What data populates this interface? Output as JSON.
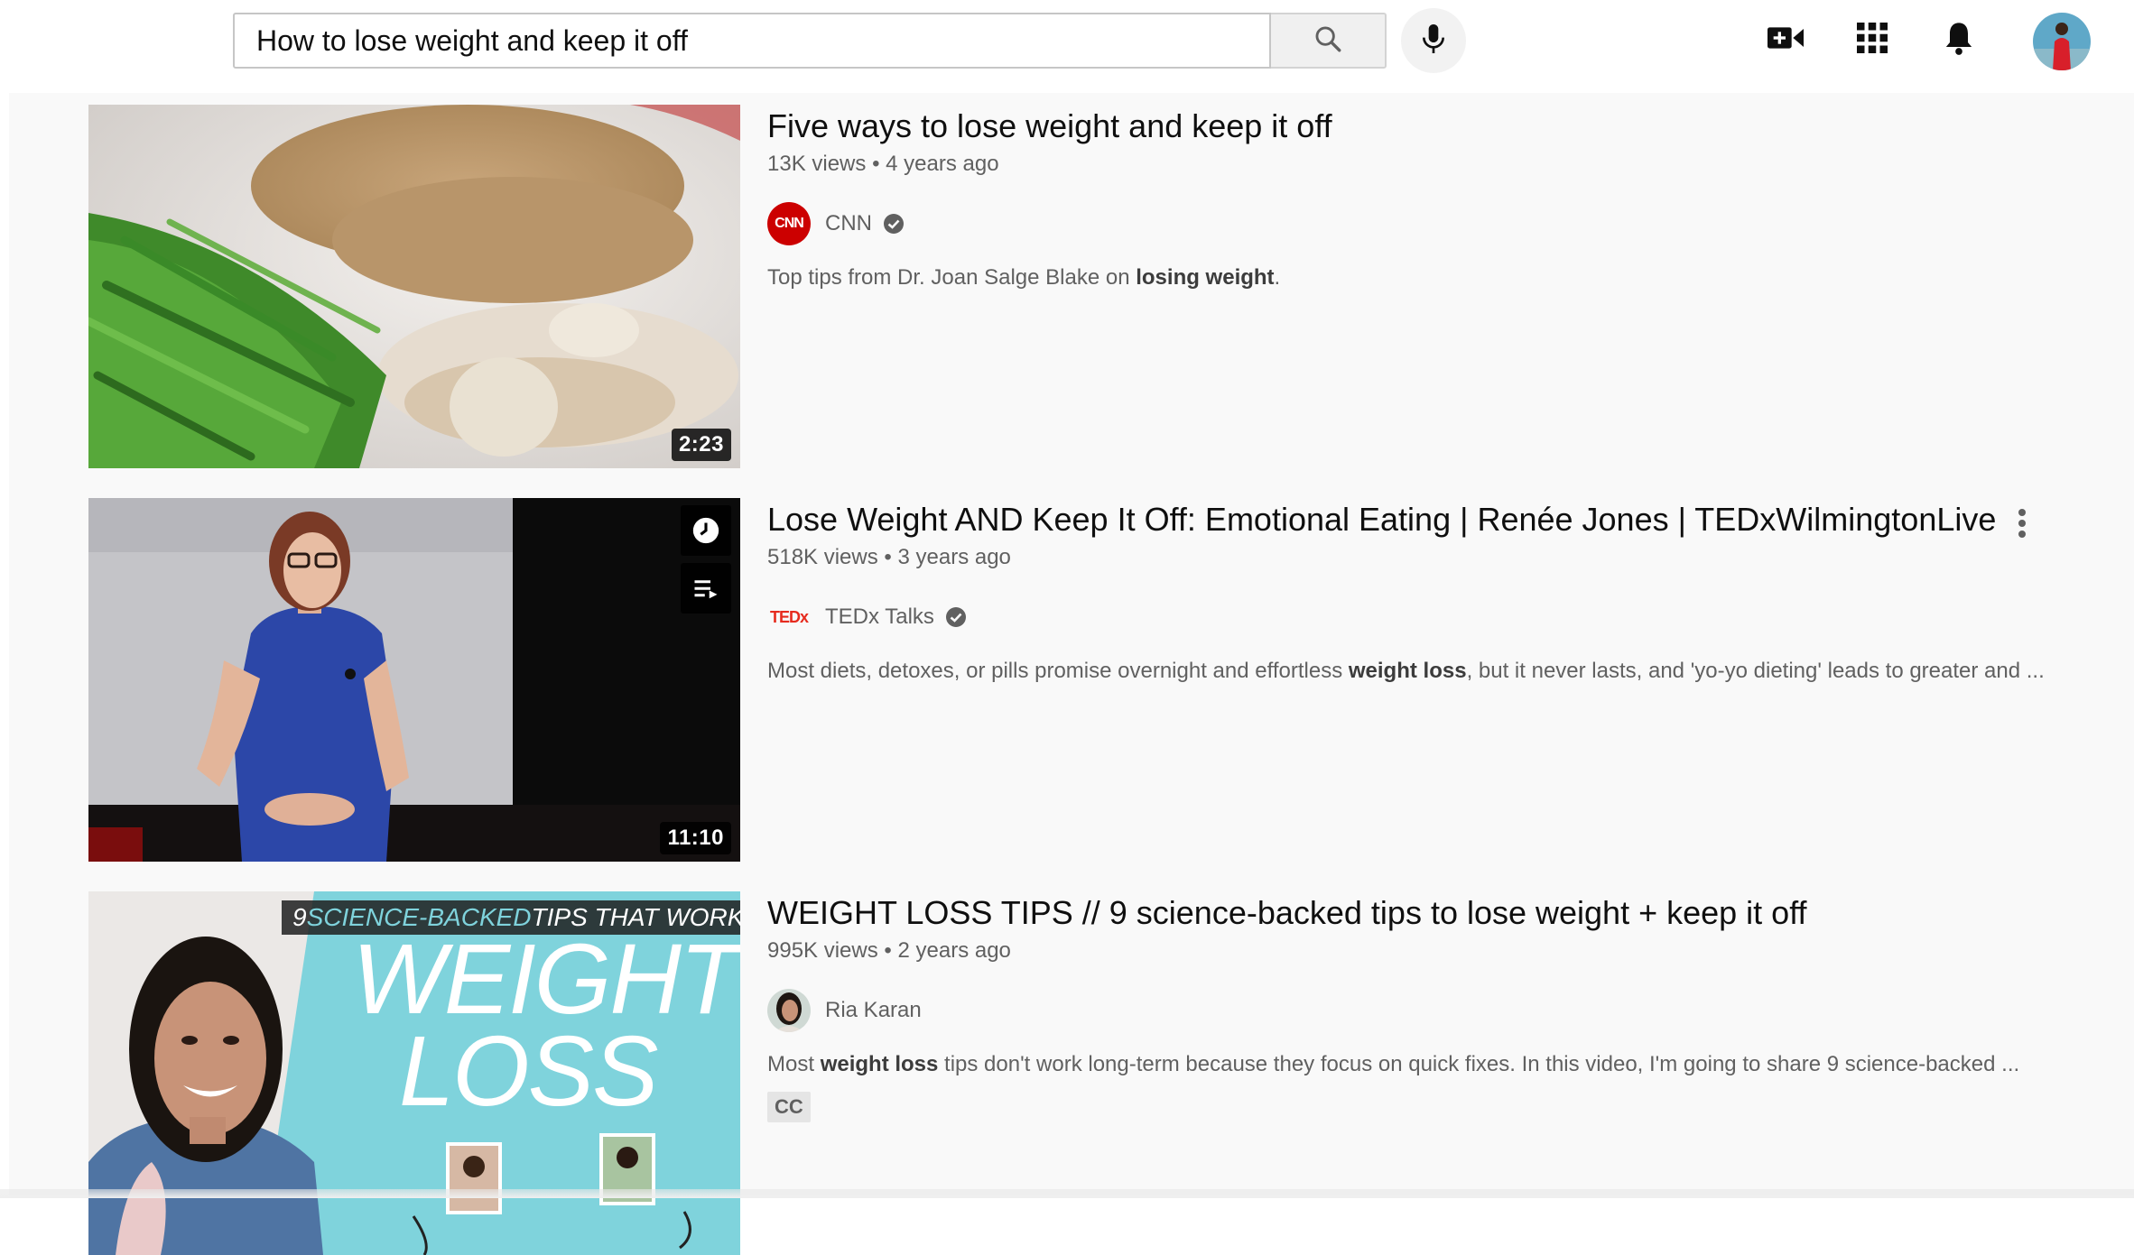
{
  "search": {
    "query": "How to lose weight and keep it off"
  },
  "header": {
    "icons": [
      "search-icon",
      "mic-icon",
      "create-video-icon",
      "apps-grid-icon",
      "bell-icon",
      "avatar"
    ]
  },
  "results": [
    {
      "title": "Five ways to lose weight and keep it off",
      "views": "13K views",
      "age": "4 years ago",
      "channel": "CNN",
      "channel_logo_text": "CNN",
      "verified": true,
      "duration": "2:23",
      "description_parts": [
        "Top tips from Dr. Joan Salge Blake on ",
        "losing weight",
        "."
      ]
    },
    {
      "title": "Lose Weight AND Keep It Off: Emotional Eating | Renée Jones | TEDxWilmingtonLive",
      "views": "518K views",
      "age": "3 years ago",
      "channel": "TEDx Talks",
      "channel_logo_text": "TEDx",
      "verified": true,
      "duration": "11:10",
      "description_parts": [
        "Most diets, detoxes, or pills promise overnight and effortless ",
        "weight loss",
        ", but it never lasts, and 'yo-yo dieting' leads to greater and ..."
      ]
    },
    {
      "title": "WEIGHT LOSS TIPS // 9 science-backed tips to lose weight + keep it off",
      "views": "995K views",
      "age": "2 years ago",
      "channel": "Ria Karan",
      "verified": false,
      "thumb_banner_prefix": "9 ",
      "thumb_banner_accent": "SCIENCE-BACKED",
      "thumb_banner_suffix": " TIPS THAT WORK",
      "thumb_big_1": "WEIGHT",
      "thumb_big_2": "LOSS",
      "description_parts": [
        "Most ",
        "weight loss",
        " tips don't work long-term because they focus on quick fixes. In this video, I'm going to share 9 science-backed ..."
      ],
      "badge": "CC"
    }
  ],
  "meta_separator": "•",
  "colors": {
    "background": "#f9f9f9",
    "text_primary": "#0f0f0f",
    "text_secondary": "#606060",
    "cnn_red": "#cc0000",
    "ted_red": "#e62b1e",
    "teal": "#7fd3dc"
  }
}
